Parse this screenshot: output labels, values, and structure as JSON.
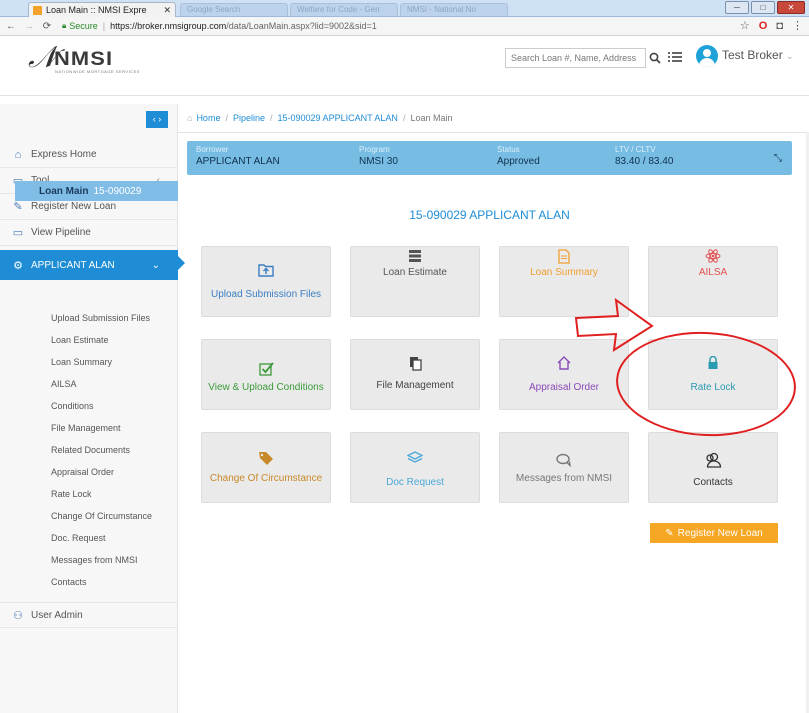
{
  "browser": {
    "tab_title": "Loan Main :: NMSI Expre",
    "tab_close": "✕",
    "faded_tabs": [
      "Google Search",
      "Welfare for Code - Gen",
      "NMSI - National No"
    ],
    "secure_label": "Secure",
    "url_host": "https://broker.nmsigroup.com",
    "url_path": "/data/LoanMain.aspx?lid=9002&sid=1"
  },
  "header": {
    "logo_text": "NMSI",
    "logo_tagline": "NATIONWIDE MORTGAGE SERVICES",
    "search_placeholder": "Search Loan #, Name, Address",
    "user_name": "Test Broker"
  },
  "sidebar": {
    "toggle_label": "‹ ›",
    "items": [
      {
        "label": "Express Home",
        "icon": "home-icon"
      },
      {
        "label": "Tool",
        "icon": "tool-icon"
      },
      {
        "label": "Register New Loan",
        "icon": "edit-icon"
      },
      {
        "label": "View Pipeline",
        "icon": "monitor-icon"
      },
      {
        "label": "APPLICANT ALAN",
        "icon": "gear-icon"
      }
    ],
    "sub_head": {
      "label": "Loan Main",
      "number": "15-090029"
    },
    "sub_items": [
      "Upload Submission Files",
      "Loan Estimate",
      "Loan Summary",
      "AILSA",
      "Conditions",
      "File Management",
      "Related Documents",
      "Appraisal Order",
      "Rate Lock",
      "Change Of Circumstance",
      "Doc. Request",
      "Messages from NMSI",
      "Contacts"
    ],
    "user_admin": "User Admin"
  },
  "breadcrumb": [
    "Home",
    "Pipeline",
    "15-090029 APPLICANT ALAN",
    "Loan Main"
  ],
  "infobar": {
    "borrower_label": "Borrower",
    "borrower": "APPLICANT ALAN",
    "program_label": "Program",
    "program": "NMSI 30",
    "status_label": "Status",
    "status": "Approved",
    "ltv_label": "LTV / CLTV",
    "ltv": "83.40 / 83.40"
  },
  "loan_title": "15-090029 APPLICANT ALAN",
  "tiles": [
    {
      "label": "Upload Submission Files",
      "color": "#3b7fc2",
      "icon": "upload-folder-icon"
    },
    {
      "label": "Loan Estimate",
      "color": "#555555",
      "icon": "server-icon"
    },
    {
      "label": "Loan Summary",
      "color": "#f0a030",
      "icon": "document-icon"
    },
    {
      "label": "AILSA",
      "color": "#e05050",
      "icon": "atom-icon"
    },
    {
      "label": "View & Upload Conditions",
      "color": "#3a9a3a",
      "icon": "check-icon"
    },
    {
      "label": "File Management",
      "color": "#444444",
      "icon": "files-icon"
    },
    {
      "label": "Appraisal Order",
      "color": "#8a4ab8",
      "icon": "house-icon"
    },
    {
      "label": "Rate Lock",
      "color": "#2a9ab0",
      "icon": "lock-icon"
    },
    {
      "label": "Change Of Circumstance",
      "color": "#c8892a",
      "icon": "tag-icon"
    },
    {
      "label": "Doc Request",
      "color": "#4aa8d8",
      "icon": "layers-icon"
    },
    {
      "label": "Messages from NMSI",
      "color": "#777777",
      "icon": "chat-icon"
    },
    {
      "label": "Contacts",
      "color": "#333333",
      "icon": "contacts-icon"
    }
  ],
  "register_button": "Register New Loan"
}
